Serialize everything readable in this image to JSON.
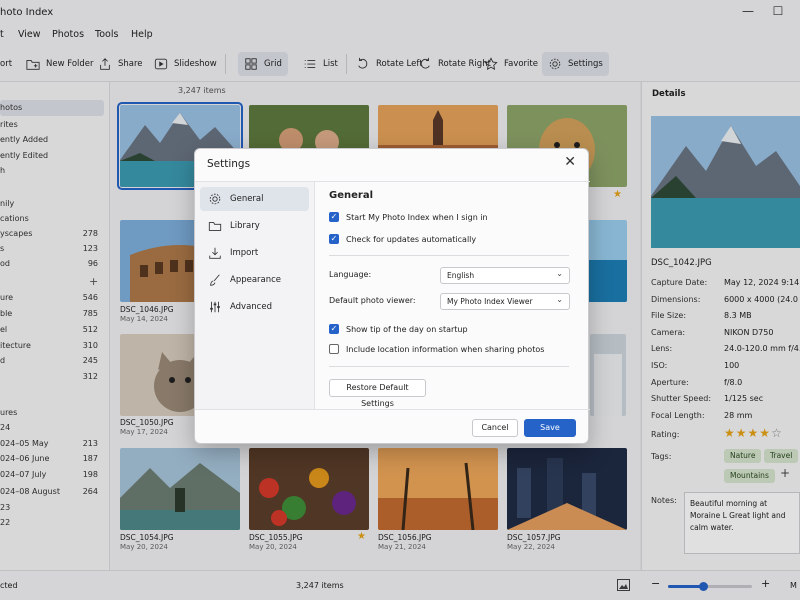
{
  "window": {
    "title": "hoto Index"
  },
  "menu": [
    "t",
    "View",
    "Photos",
    "Tools",
    "Help"
  ],
  "toolbar": {
    "import": "ort",
    "new_folder": "New Folder",
    "share": "Share",
    "slideshow": "Slideshow",
    "grid": "Grid",
    "list": "List",
    "rotate_left": "Rotate Left",
    "rotate_right": "Rotate Right",
    "favorite": "Favorite",
    "settings": "Settings"
  },
  "sidebar": {
    "items": [
      {
        "label": "hotos"
      },
      {
        "label": "rites"
      },
      {
        "label": "ently Added"
      },
      {
        "label": "ently Edited"
      },
      {
        "label": "h"
      },
      {
        "label": "nily"
      },
      {
        "label": "cations"
      },
      {
        "label": "yscapes",
        "count": "278"
      },
      {
        "label": "s",
        "count": "123"
      },
      {
        "label": "od",
        "count": "96"
      },
      {
        "label": "ure",
        "count": "546"
      },
      {
        "label": "ble",
        "count": "785"
      },
      {
        "label": "el",
        "count": "512"
      },
      {
        "label": "itecture",
        "count": "310"
      },
      {
        "label": "d",
        "count": "245"
      },
      {
        "label": "",
        "count": "312"
      },
      {
        "label": "ures"
      },
      {
        "label": "24"
      },
      {
        "label": "024–05 May",
        "count": "213"
      },
      {
        "label": "024–06 June",
        "count": "187"
      },
      {
        "label": "024–07 July",
        "count": "198"
      },
      {
        "label": "024–08 August",
        "count": "264"
      },
      {
        "label": "23"
      },
      {
        "label": "22"
      }
    ]
  },
  "grid": {
    "count": "3,247 items",
    "thumbs": [
      {
        "name": "DSC_1046.JPG",
        "date": "May 14, 2024"
      },
      {
        "name": "DSC_1050.JPG",
        "date": "May 17, 2024"
      },
      {
        "name": "DSC_1054.JPG",
        "date": "May 20, 2024"
      },
      {
        "name": "DSC_1055.JPG",
        "date": "May 20, 2024"
      },
      {
        "name": "DSC_1056.JPG",
        "date": "May 21, 2024"
      },
      {
        "name": "DSC_1057.JPG",
        "date": "May 22, 2024"
      }
    ]
  },
  "details": {
    "header": "Details",
    "filename": "DSC_1042.JPG",
    "rows": [
      {
        "label": "Capture Date:",
        "value": "May 12, 2024   9:14:2"
      },
      {
        "label": "Dimensions:",
        "value": "6000 x 4000 (24.0 M"
      },
      {
        "label": "File Size:",
        "value": "8.3 MB"
      },
      {
        "label": "Camera:",
        "value": "NIKON D750"
      },
      {
        "label": "Lens:",
        "value": "24.0-120.0 mm f/4.0"
      },
      {
        "label": "ISO:",
        "value": "100"
      },
      {
        "label": "Aperture:",
        "value": "f/8.0"
      },
      {
        "label": "Shutter Speed:",
        "value": "1/125 sec"
      },
      {
        "label": "Focal Length:",
        "value": "28 mm"
      }
    ],
    "rating_label": "Rating:",
    "rating": 4,
    "rating_max": 5,
    "tags_label": "Tags:",
    "tags": [
      "Nature",
      "Travel",
      "Mountains"
    ],
    "notes_label": "Notes:",
    "notes": "Beautiful morning at Moraine L Great light and calm water."
  },
  "status": {
    "left": "cted",
    "center": "3,247 items",
    "right": "M"
  },
  "zoom": {
    "level": 0.42
  },
  "settings_dialog": {
    "title": "Settings",
    "nav": [
      "General",
      "Library",
      "Import",
      "Appearance",
      "Advanced"
    ],
    "section": "General",
    "start_on_signin": "Start My Photo Index when I sign in",
    "check_updates": "Check for updates automatically",
    "language_label": "Language:",
    "language_value": "English",
    "viewer_label": "Default photo viewer:",
    "viewer_value": "My Photo Index Viewer",
    "show_tip": "Show tip of the day on startup",
    "include_location": "Include location information when sharing photos",
    "restore": "Restore Default Settings",
    "cancel": "Cancel",
    "save": "Save"
  },
  "colors": {
    "accent": "#2563c9",
    "star": "#e8a317",
    "tag_bg": "#d7e6cf"
  }
}
